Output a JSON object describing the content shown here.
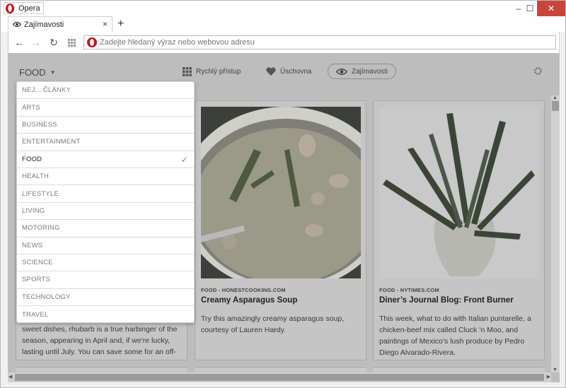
{
  "window": {
    "app_label": "Opera",
    "controls": {
      "minimize": "–",
      "maximize": "☐",
      "close": "✕"
    }
  },
  "tab": {
    "label": "Zajímavosti",
    "close": "×",
    "new_tab": "+"
  },
  "toolbar": {
    "back": "←",
    "forward": "→",
    "reload": "↻",
    "address_placeholder": "Zadejte hledaný výraz nebo webovou adresu"
  },
  "page": {
    "category_label": "FOOD",
    "nav": [
      {
        "label": "Rychlý přístup",
        "icon": "grid-icon"
      },
      {
        "label": "Úschovna",
        "icon": "heart-icon"
      },
      {
        "label": "Zajímavosti",
        "icon": "eye-icon"
      }
    ]
  },
  "dropdown": {
    "items": [
      {
        "label": "NEJ... ČLÁNKY"
      },
      {
        "label": "ARTS"
      },
      {
        "label": "BUSINESS"
      },
      {
        "label": "ENTERTAINMENT"
      },
      {
        "label": "FOOD",
        "check": "✓"
      },
      {
        "label": "HEALTH"
      },
      {
        "label": "LIFESTYLE"
      },
      {
        "label": "LIVING"
      },
      {
        "label": "MOTORING"
      },
      {
        "label": "NEWS"
      },
      {
        "label": "SCIENCE"
      },
      {
        "label": "SPORTS"
      },
      {
        "label": "TECHNOLOGY"
      },
      {
        "label": "TRAVEL"
      }
    ],
    "selected": "FOOD"
  },
  "cards": [
    {
      "source": "",
      "title": "",
      "description": "sweet dishes, rhubarb is a true harbinger of the season, appearing in April and, if we're lucky, lasting until July. You can save some for an off-"
    },
    {
      "source": "FOOD - HONESTCOOKING.COM",
      "title": "Creamy Asparagus Soup",
      "description": "Try this amazingly creamy asparagus soup, courtesy of Lauren Hardy."
    },
    {
      "source": "FOOD - NYTIMES.COM",
      "title": "Diner’s Journal Blog: Front Burner",
      "description": "This week, what to do with Italian puntarelle, a chicken-beef mix called Cluck ‘n Moo, and paintings of Mexico’s lush produce by Pedro Diego Alvarado-Rivera."
    }
  ],
  "colors": {
    "opera_red": "#cc0f16",
    "close_red": "#c7463a",
    "overlay": "#bdbdbd"
  }
}
